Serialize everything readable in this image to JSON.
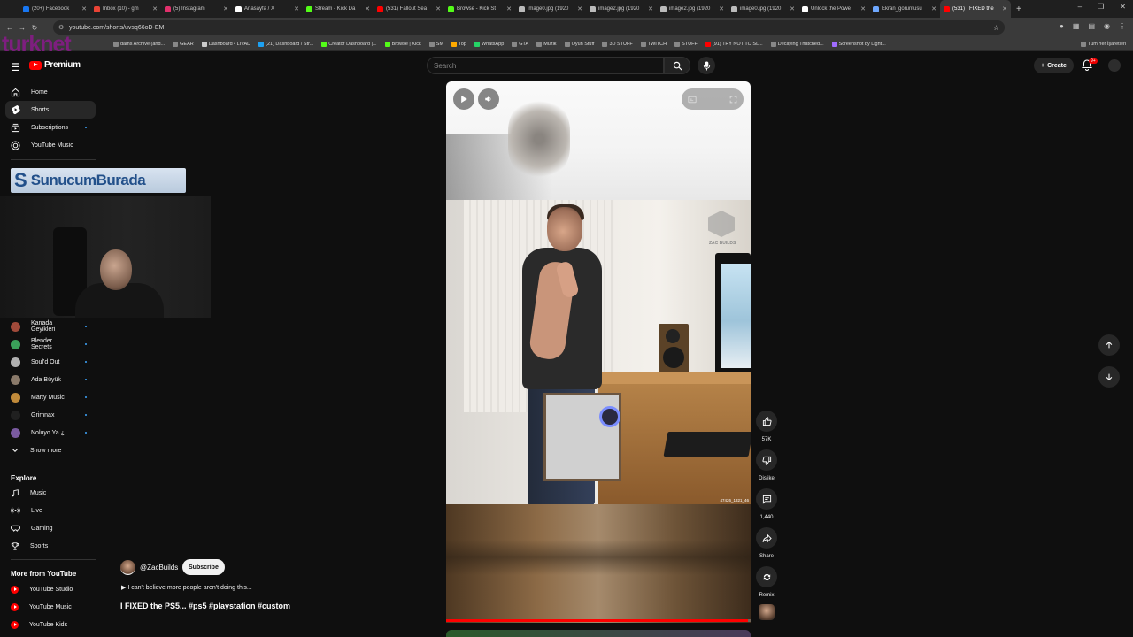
{
  "browser": {
    "tabs": [
      {
        "title": "(20+) Facebook",
        "color": "#1877f2"
      },
      {
        "title": "Inbox (10) - gm",
        "color": "#ea4335"
      },
      {
        "title": "(5) Instagram",
        "color": "#e1306c"
      },
      {
        "title": "Anasayfa / X",
        "color": "#ffffff"
      },
      {
        "title": "Stream - Kick Da",
        "color": "#53fc18"
      },
      {
        "title": "(531) Fallout Sea",
        "color": "#ff0000"
      },
      {
        "title": "Browse - Kick St",
        "color": "#53fc18"
      },
      {
        "title": "image0.jpg (1920",
        "color": "#bbbbbb"
      },
      {
        "title": "image2.jpg (1920",
        "color": "#bbbbbb"
      },
      {
        "title": "image2.jpg (1920",
        "color": "#bbbbbb"
      },
      {
        "title": "image0.jpg (1920",
        "color": "#bbbbbb"
      },
      {
        "title": "Unlock the Powe",
        "color": "#ffffff"
      },
      {
        "title": "Ekran_goruntusu",
        "color": "#6fa8ff"
      },
      {
        "title": "(531) I FIXED the",
        "color": "#ff0000"
      }
    ],
    "active_tab_index": 13,
    "url": "youtube.com/shorts/uvsq66oD-EM",
    "bookmarks": [
      {
        "label": "dams Archive (and...",
        "color": "#888888"
      },
      {
        "label": "GEAR",
        "color": "#888888"
      },
      {
        "label": "Dashboard • LIVAD",
        "color": "#cccccc"
      },
      {
        "label": "(21) Dashboard / Str...",
        "color": "#1da1f2"
      },
      {
        "label": "Creator Dashboard |...",
        "color": "#53fc18"
      },
      {
        "label": "Browse | Kick",
        "color": "#53fc18"
      },
      {
        "label": "SM",
        "color": "#888888"
      },
      {
        "label": "Top",
        "color": "#ffaa00"
      },
      {
        "label": "WhatsApp",
        "color": "#25d366"
      },
      {
        "label": "GTA",
        "color": "#888888"
      },
      {
        "label": "Müzik",
        "color": "#888888"
      },
      {
        "label": "Oyun Stuff",
        "color": "#888888"
      },
      {
        "label": "3D STUFF",
        "color": "#888888"
      },
      {
        "label": "TWITCH",
        "color": "#888888"
      },
      {
        "label": "STUFF",
        "color": "#888888"
      },
      {
        "label": "(91) TRY NOT TO SL...",
        "color": "#ff0000"
      },
      {
        "label": "Decaying Thatched...",
        "color": "#888888"
      },
      {
        "label": "Screenshot by Light...",
        "color": "#a06cff"
      }
    ],
    "bookmarks_end": "Tüm Yer İşaretleri"
  },
  "overlay": {
    "brand": "turknet",
    "banner": "SunucumBurada",
    "banner_mark": "S"
  },
  "youtube": {
    "logo_suffix": "Premium",
    "search_placeholder": "Search",
    "create_label": "Create",
    "notifications_badge": "9+",
    "sidebar": {
      "main": [
        {
          "label": "Home",
          "icon": "home-icon"
        },
        {
          "label": "Shorts",
          "icon": "shorts-icon"
        },
        {
          "label": "Subscriptions",
          "icon": "subscriptions-icon"
        },
        {
          "label": "YouTube Music",
          "icon": "music-icon"
        }
      ],
      "subscriptions": [
        {
          "label": "Kanada Geyikleri",
          "color": "#a04a3a"
        },
        {
          "label": "Blender Secrets",
          "color": "#3aa05a"
        },
        {
          "label": "Soul'd Out",
          "color": "#b0b0b0"
        },
        {
          "label": "Ada Büyük",
          "color": "#8a7a6a"
        },
        {
          "label": "Marty Music",
          "color": "#c08a3a"
        },
        {
          "label": "Grimnax",
          "color": "#202020"
        },
        {
          "label": "Noluyo Ya ¿",
          "color": "#7a5aa0"
        }
      ],
      "show_more": "Show more",
      "explore_heading": "Explore",
      "explore": [
        {
          "label": "Music",
          "icon": "music-note-icon"
        },
        {
          "label": "Live",
          "icon": "live-icon"
        },
        {
          "label": "Gaming",
          "icon": "gaming-icon"
        },
        {
          "label": "Sports",
          "icon": "trophy-icon"
        }
      ],
      "more_heading": "More from YouTube",
      "more": [
        {
          "label": "YouTube Studio"
        },
        {
          "label": "YouTube Music"
        },
        {
          "label": "YouTube Kids"
        }
      ]
    },
    "short": {
      "watermark": "ZAC BUILDS",
      "credit": "47426_1321_46",
      "progress": 0.99,
      "channel": "@ZacBuilds",
      "subscribe_label": "Subscribe",
      "description": "I can't believe more people aren't doing this...",
      "title": "I FIXED the PS5... #ps5 #playstation #custom",
      "actions": {
        "like_count": "57K",
        "dislike_label": "Dislike",
        "comment_count": "1,440",
        "share_label": "Share",
        "remix_label": "Remix"
      }
    }
  }
}
